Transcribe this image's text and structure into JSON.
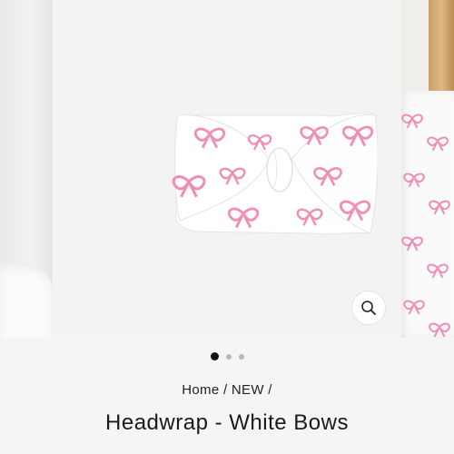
{
  "gallery": {
    "slide_count": 3,
    "active_index": 0,
    "zoom_icon": "magnifier-icon"
  },
  "breadcrumb": {
    "home": "Home",
    "separator": "/",
    "category": "NEW",
    "trailing_separator": "/"
  },
  "product": {
    "title": "Headwrap - White Bows",
    "fabric_color": "#ffffff",
    "print_color": "#f08fb4"
  }
}
